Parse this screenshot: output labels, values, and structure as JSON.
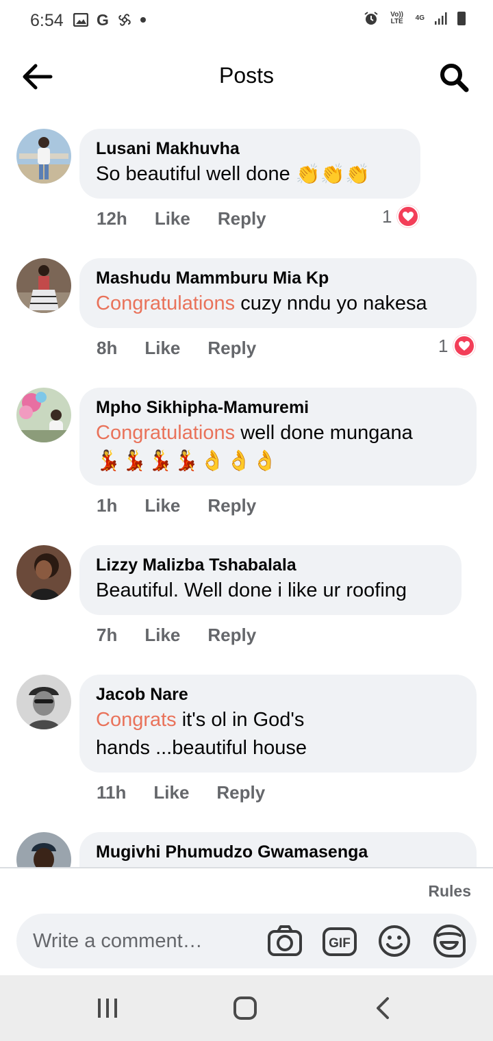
{
  "status_bar": {
    "time": "6:54",
    "left_icons": [
      "image-icon",
      "google-icon",
      "pinwheel-icon",
      "dot-icon"
    ],
    "right_icons": [
      "alarm-icon",
      "volte-icon",
      "4g-icon",
      "signal-icon",
      "battery-icon"
    ],
    "volte_label": "Vo)) LTE",
    "network_label": "4G"
  },
  "header": {
    "title": "Posts"
  },
  "comments": [
    {
      "author": "Lusani Makhuvha",
      "text_highlight": "",
      "text": "So beautiful well done",
      "emojis": "👏👏👏",
      "time": "12h",
      "like_label": "Like",
      "reply_label": "Reply",
      "reaction_count": "1"
    },
    {
      "author": "Mashudu Mammburu Mia Kp",
      "text_highlight": "Congratulations",
      "text": " cuzy nndu yo nakesa",
      "emojis": "",
      "time": "8h",
      "like_label": "Like",
      "reply_label": "Reply",
      "reaction_count": "1"
    },
    {
      "author": "Mpho Sikhipha-Mamuremi",
      "text_highlight": "Congratulations",
      "text": " well done mungana",
      "emojis": "💃💃💃💃👌👌👌",
      "time": "1h",
      "like_label": "Like",
      "reply_label": "Reply"
    },
    {
      "author": "Lizzy Malizba Tshabalala",
      "text_highlight": "",
      "text": "Beautiful. Well done i like ur roofing",
      "emojis": "",
      "time": "7h",
      "like_label": "Like",
      "reply_label": "Reply"
    },
    {
      "author": "Jacob Nare",
      "text_highlight": "Congrats",
      "text": " it's ol in God's",
      "text_line2": "hands ...beautiful house",
      "emojis": "",
      "time": "11h",
      "like_label": "Like",
      "reply_label": "Reply"
    },
    {
      "author": "Mugivhi Phumudzo Gwamasenga"
    }
  ],
  "composer": {
    "rules_label": "Rules",
    "placeholder": "Write a comment…",
    "gif_label": "GIF"
  },
  "colors": {
    "highlight": "#e9725a",
    "bubble": "#f0f2f5",
    "secondary_text": "#65676b",
    "love_reaction": "#f33e58"
  }
}
